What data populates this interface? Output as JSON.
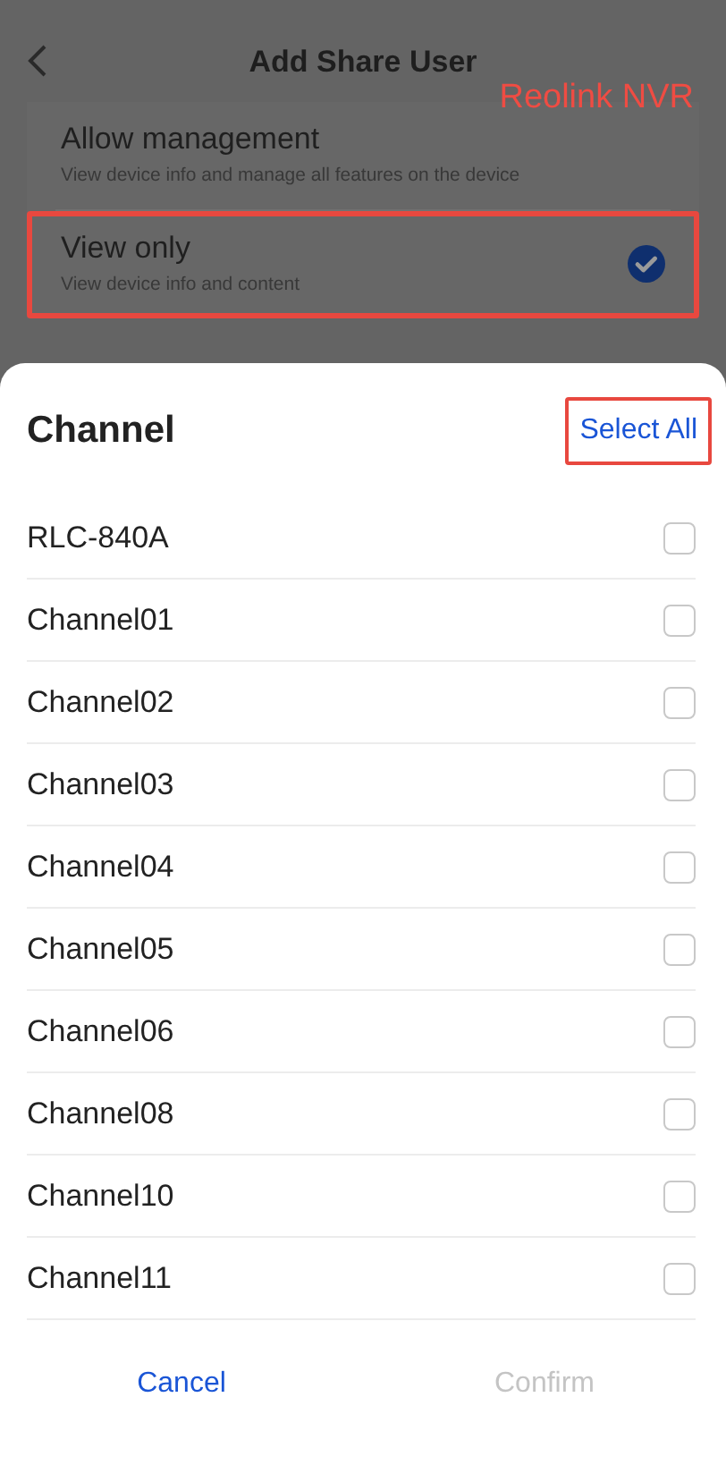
{
  "header": {
    "title": "Add Share User"
  },
  "annotation": {
    "label": "Reolink NVR"
  },
  "permissions": [
    {
      "title": "Allow management",
      "description": "View device info and manage all features on the device",
      "selected": false,
      "highlighted": false
    },
    {
      "title": "View only",
      "description": "View device info and content",
      "selected": true,
      "highlighted": true
    }
  ],
  "sheet": {
    "title": "Channel",
    "select_all": {
      "label": "Select All",
      "highlighted": true
    },
    "channels": [
      {
        "name": "RLC-840A",
        "checked": false
      },
      {
        "name": "Channel01",
        "checked": false
      },
      {
        "name": "Channel02",
        "checked": false
      },
      {
        "name": "Channel03",
        "checked": false
      },
      {
        "name": "Channel04",
        "checked": false
      },
      {
        "name": "Channel05",
        "checked": false
      },
      {
        "name": "Channel06",
        "checked": false
      },
      {
        "name": "Channel08",
        "checked": false
      },
      {
        "name": "Channel10",
        "checked": false
      },
      {
        "name": "Channel11",
        "checked": false
      }
    ],
    "buttons": [
      {
        "label": "Cancel",
        "disabled": false
      },
      {
        "label": "Confirm",
        "disabled": true
      }
    ]
  }
}
